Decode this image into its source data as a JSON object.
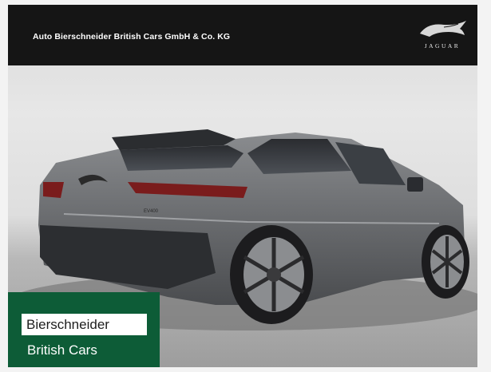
{
  "header": {
    "dealer_name": "Auto Bierschneider British Cars GmbH & Co. KG",
    "brand_logo": {
      "wordmark": "JAGUAR",
      "icon": "leaping-jaguar-icon"
    }
  },
  "photo": {
    "subject_icon": "car-icon",
    "vehicle_badge": "EV400"
  },
  "dealer_badge": {
    "line1": "Bierschneider",
    "line2": "British Cars"
  },
  "colors": {
    "header_bg": "#151515",
    "badge_green": "#0d5c37",
    "car_body": "#6b6d70"
  }
}
